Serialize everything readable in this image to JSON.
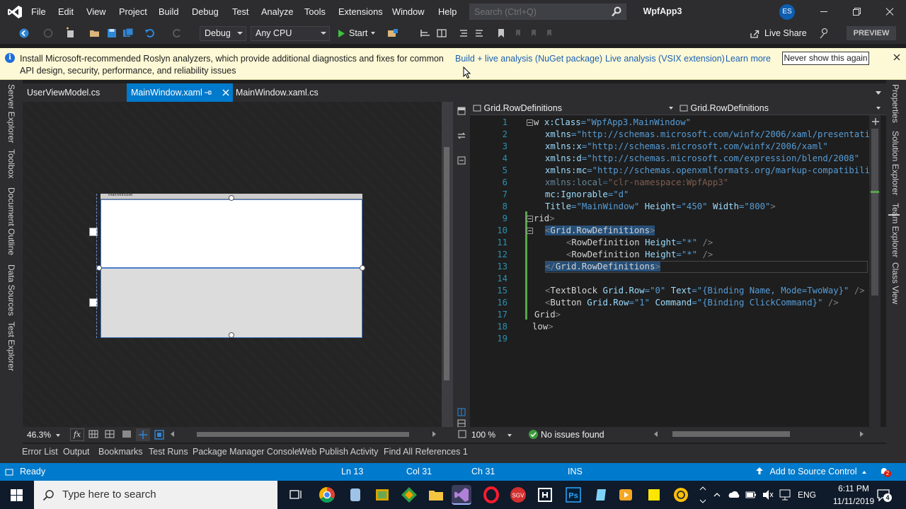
{
  "menu": [
    "File",
    "Edit",
    "View",
    "Project",
    "Build",
    "Debug",
    "Test",
    "Analyze",
    "Tools",
    "Extensions",
    "Window",
    "Help"
  ],
  "search": {
    "placeholder": "Search (Ctrl+Q)"
  },
  "solution_name": "WpfApp3",
  "user_initials": "ES",
  "toolbar": {
    "configuration": "Debug",
    "platform": "Any CPU",
    "start_label": "Start",
    "live_share_label": "Live Share",
    "preview_label": "PREVIEW"
  },
  "infobar": {
    "message": "Install Microsoft-recommended Roslyn analyzers, which provide additional diagnostics and fixes for common API design, security, performance, and reliability issues",
    "link_nuget": "Build + live analysis (NuGet package)",
    "link_vsix": "Live analysis (VSIX extension)",
    "link_learn": "Learn more",
    "never_show": "Never show this again"
  },
  "left_tools": [
    "Server Explorer",
    "Toolbox",
    "Document Outline",
    "Data Sources",
    "Test Explorer"
  ],
  "right_tools": [
    "Properties",
    "Solution Explorer",
    "Team Explorer",
    "Class View"
  ],
  "doc_tabs": [
    {
      "label": "UserViewModel.cs",
      "active": false
    },
    {
      "label": "MainWindow.xaml",
      "active": true
    },
    {
      "label": "MainWindow.xaml.cs",
      "active": false
    }
  ],
  "designer": {
    "window_title": "MainWindow",
    "zoom": "46.3%",
    "fx_label": "fx"
  },
  "editor": {
    "nav_left": "Grid.RowDefinitions",
    "nav_right": "Grid.RowDefinitions",
    "zoom": "100 %",
    "issues": "No issues found",
    "line_numbers": [
      "1",
      "2",
      "3",
      "4",
      "5",
      "6",
      "7",
      "8",
      "9",
      "10",
      "11",
      "12",
      "13",
      "14",
      "15",
      "16",
      "17",
      "18",
      "19"
    ]
  },
  "code": {
    "l1": [
      "w ",
      "x:Class",
      "=",
      "\"WpfApp3.MainWindow\""
    ],
    "l2": [
      "xmlns",
      "=",
      "\"http://schemas.microsoft.com/winfx/2006/xaml/presentati"
    ],
    "l3": [
      "xmlns:x",
      "=",
      "\"http://schemas.microsoft.com/winfx/2006/xaml\""
    ],
    "l4": [
      "xmlns:d",
      "=",
      "\"http://schemas.microsoft.com/expression/blend/2008\""
    ],
    "l5": [
      "xmlns:mc",
      "=",
      "\"http://schemas.openxmlformats.org/markup-compatibili"
    ],
    "l6": [
      "xmlns:local",
      "=",
      "\"clr-namespace:WpfApp3\""
    ],
    "l7": [
      "mc:Ignorable",
      "=",
      "\"d\""
    ],
    "l8": [
      "Title",
      "=",
      "\"MainWindow\"",
      "Height",
      "=",
      "\"450\"",
      "Width",
      "=",
      "\"800\"",
      ">"
    ],
    "l9": [
      "rid",
      ">"
    ],
    "l10": [
      "<",
      "Grid.RowDefinitions",
      ">"
    ],
    "l11": [
      "<",
      "RowDefinition",
      "Height",
      "=",
      "\"*\"",
      "/>"
    ],
    "l12": [
      "<",
      "RowDefinition",
      "Height",
      "=",
      "\"*\"",
      "/>"
    ],
    "l13": [
      "</",
      "Grid.RowDefinitions",
      ">"
    ],
    "l15": [
      "<",
      "TextBlock",
      "Grid.Row",
      "=",
      "\"0\"",
      "Text",
      "=",
      "\"{Binding Name, Mode=TwoWay}\"",
      "/>"
    ],
    "l16": [
      "<",
      "Button",
      "Grid.Row",
      "=",
      "\"1\"",
      "Command",
      "=",
      "\"{Binding ClickCommand}\"",
      "/>"
    ],
    "l17": [
      "Grid",
      ">"
    ],
    "l18": [
      "low",
      ">"
    ]
  },
  "bottom_tabs": [
    "Error List",
    "Output",
    "Bookmarks",
    "Test Runs",
    "Package Manager Console",
    "Web Publish Activity",
    "Find All References 1"
  ],
  "status": {
    "ready": "Ready",
    "ln": "Ln 13",
    "col": "Col 31",
    "ch": "Ch 31",
    "ins": "INS",
    "source_control": "Add to Source Control",
    "notifications": "2"
  },
  "taskbar": {
    "search_placeholder": "Type here to search",
    "lang": "ENG",
    "time": "6:11 PM",
    "date": "11/11/2019",
    "notif_count": "4"
  },
  "colors": {
    "accent": "#007acc",
    "infobar_bg": "#fdf9d6",
    "link": "#1a5fb4",
    "line_number": "#2b91af",
    "xml_tag": "#569cd6",
    "xml_attr": "#9cdcfe",
    "xml_string": "#ce9178"
  }
}
